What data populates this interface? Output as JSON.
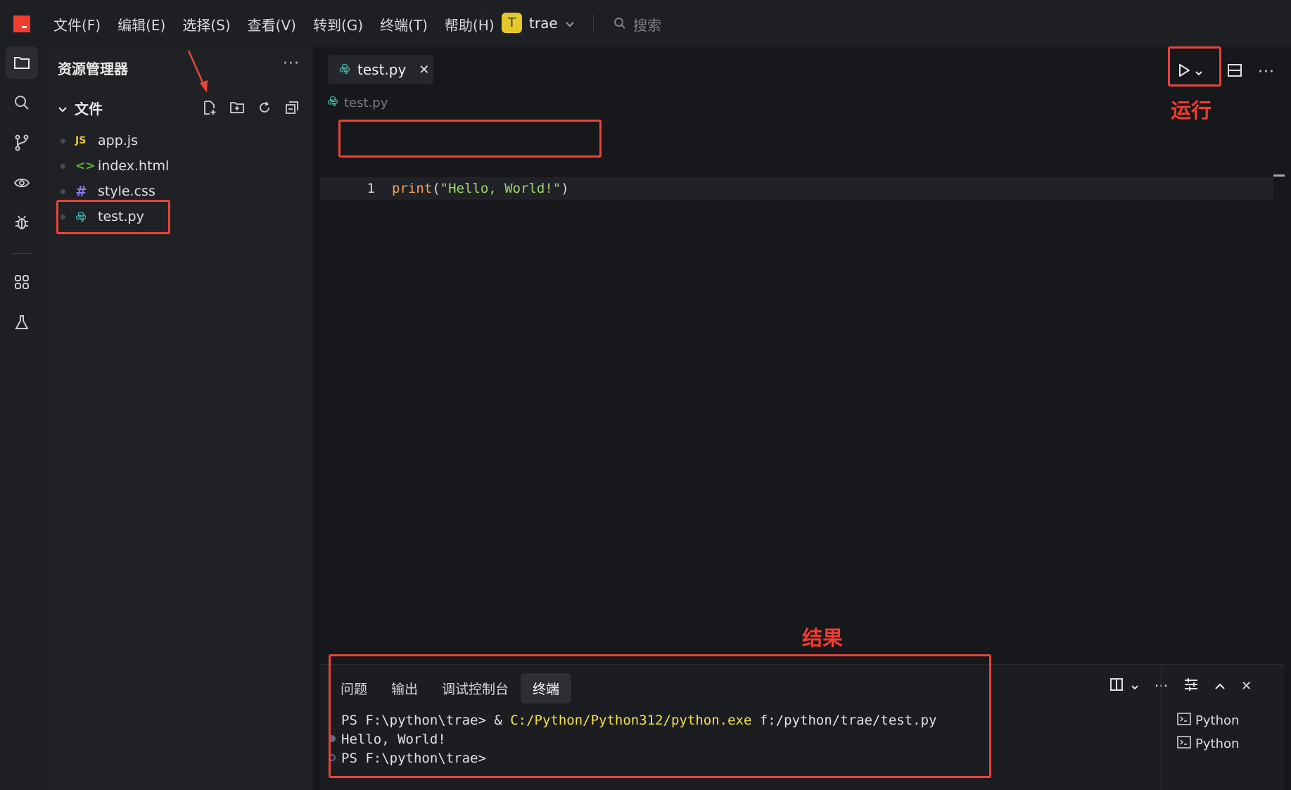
{
  "titlebar": {
    "menu": [
      "文件(F)",
      "编辑(E)",
      "选择(S)",
      "查看(V)",
      "转到(G)",
      "终端(T)",
      "帮助(H)"
    ],
    "workspace_initial": "T",
    "workspace_name": "trae",
    "search_placeholder": "搜索"
  },
  "sidebar": {
    "title": "资源管理器",
    "section": "文件",
    "files": [
      {
        "icon": "JS",
        "name": "app.js"
      },
      {
        "icon": "<>",
        "name": "index.html"
      },
      {
        "icon": "#",
        "name": "style.css"
      },
      {
        "icon": "py",
        "name": "test.py"
      }
    ]
  },
  "editor": {
    "tab_label": "test.py",
    "breadcrumb": "test.py",
    "line_number": "1",
    "code_fn": "print",
    "code_open": "(",
    "code_str": "\"Hello, World!\"",
    "code_close": ")"
  },
  "panel": {
    "tabs": [
      "问题",
      "输出",
      "调试控制台",
      "终端"
    ],
    "active_tab": "终端",
    "terminal": {
      "line1_prompt": "PS F:\\python\\trae> & ",
      "line1_exe": "C:/Python/Python312/python.exe",
      "line1_arg": " f:/python/trae/test.py",
      "line2": "Hello, World!",
      "line3": "PS F:\\python\\trae>"
    },
    "terminal_list": [
      "Python",
      "Python"
    ]
  },
  "annotations": {
    "run_label": "运行",
    "result_label": "结果"
  },
  "colors": {
    "accent_red": "#e8443a",
    "logo_red": "#f03d2e",
    "string_green": "#9ed36c",
    "function_orange": "#f0a25d",
    "exe_yellow": "#f3e14b"
  }
}
